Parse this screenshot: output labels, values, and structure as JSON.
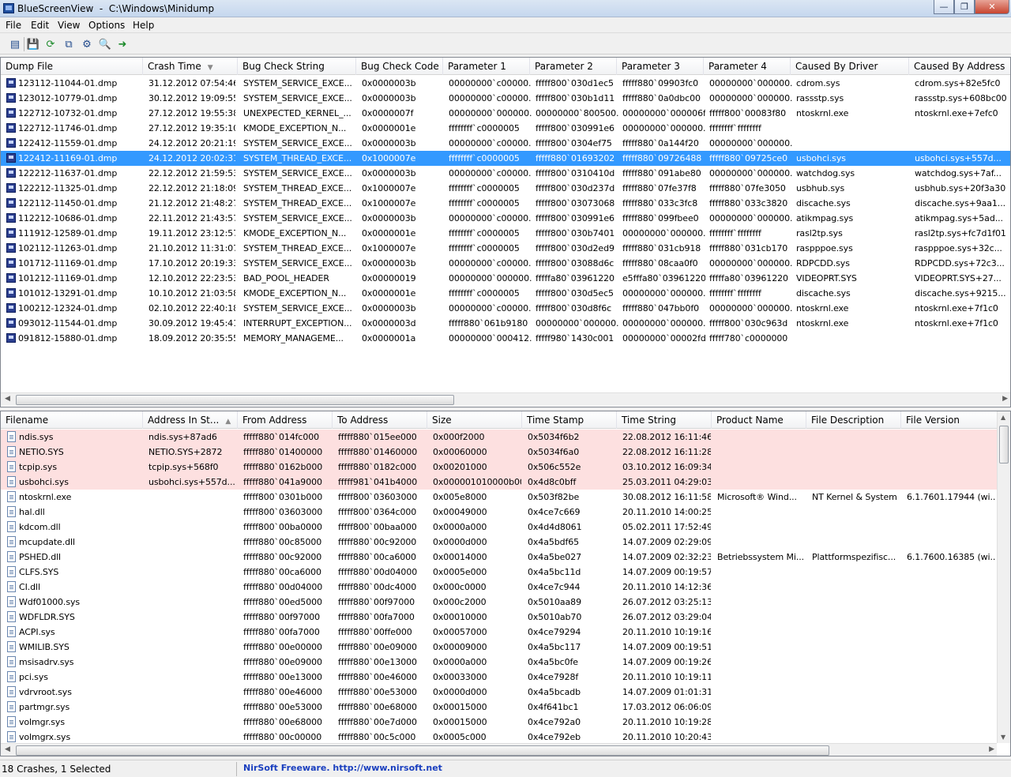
{
  "window": {
    "title": "BlueScreenView  -  C:\\Windows\\Minidump"
  },
  "menu": [
    "File",
    "Edit",
    "View",
    "Options",
    "Help"
  ],
  "toolbar_icons": [
    "properties-icon",
    "save-icon",
    "refresh-icon",
    "copy-icon",
    "advanced-options-icon",
    "find-icon",
    "exit-icon"
  ],
  "crashes": {
    "columns": [
      "Dump File",
      "Crash Time",
      "Bug Check String",
      "Bug Check Code",
      "Parameter 1",
      "Parameter 2",
      "Parameter 3",
      "Parameter 4",
      "Caused By Driver",
      "Caused By Address"
    ],
    "sort_column": "Crash Time",
    "selected_index": 5,
    "rows": [
      [
        "123112-11044-01.dmp",
        "31.12.2012 07:54:46",
        "SYSTEM_SERVICE_EXCE...",
        "0x0000003b",
        "00000000`c00000...",
        "fffff800`030d1ec5",
        "fffff880`09903fc0",
        "00000000`000000...",
        "cdrom.sys",
        "cdrom.sys+82e5fc0"
      ],
      [
        "123012-10779-01.dmp",
        "30.12.2012 19:09:55",
        "SYSTEM_SERVICE_EXCE...",
        "0x0000003b",
        "00000000`c00000...",
        "fffff800`030b1d11",
        "fffff880`0a0dbc00",
        "00000000`000000...",
        "rassstp.sys",
        "rassstp.sys+608bc00"
      ],
      [
        "122712-10732-01.dmp",
        "27.12.2012 19:55:38",
        "UNEXPECTED_KERNEL_...",
        "0x0000007f",
        "00000000`000000...",
        "00000000`800500...",
        "00000000`000006f8",
        "fffff800`00083f80",
        "ntoskrnl.exe",
        "ntoskrnl.exe+7efc0"
      ],
      [
        "122712-11746-01.dmp",
        "27.12.2012 19:35:10",
        "KMODE_EXCEPTION_N...",
        "0x0000001e",
        "ffffffff`c0000005",
        "fffff800`030991e6",
        "00000000`000000...",
        "ffffffff`ffffffff",
        "",
        ""
      ],
      [
        "122412-11559-01.dmp",
        "24.12.2012 20:21:19",
        "SYSTEM_SERVICE_EXCE...",
        "0x0000003b",
        "00000000`c00000...",
        "fffff800`0304ef75",
        "fffff880`0a144f20",
        "00000000`000000...",
        "",
        ""
      ],
      [
        "122412-11169-01.dmp",
        "24.12.2012 20:02:31",
        "SYSTEM_THREAD_EXCE...",
        "0x1000007e",
        "ffffffff`c0000005",
        "fffff880`01693202",
        "fffff880`09726488",
        "fffff880`09725ce0",
        "usbohci.sys",
        "usbohci.sys+557d..."
      ],
      [
        "122212-11637-01.dmp",
        "22.12.2012 21:59:53",
        "SYSTEM_SERVICE_EXCE...",
        "0x0000003b",
        "00000000`c00000...",
        "fffff800`0310410d",
        "fffff880`091abe80",
        "00000000`000000...",
        "watchdog.sys",
        "watchdog.sys+7af..."
      ],
      [
        "122212-11325-01.dmp",
        "22.12.2012 21:18:09",
        "SYSTEM_THREAD_EXCE...",
        "0x1000007e",
        "ffffffff`c0000005",
        "fffff800`030d237d",
        "fffff880`07fe37f8",
        "fffff880`07fe3050",
        "usbhub.sys",
        "usbhub.sys+20f3a30"
      ],
      [
        "122112-11450-01.dmp",
        "21.12.2012 21:48:27",
        "SYSTEM_THREAD_EXCE...",
        "0x1000007e",
        "ffffffff`c0000005",
        "fffff800`03073068",
        "fffff880`033c3fc8",
        "fffff880`033c3820",
        "discache.sys",
        "discache.sys+9aa1..."
      ],
      [
        "112212-10686-01.dmp",
        "22.11.2012 21:43:57",
        "SYSTEM_SERVICE_EXCE...",
        "0x0000003b",
        "00000000`c00000...",
        "fffff800`030991e6",
        "fffff880`099fbee0",
        "00000000`000000...",
        "atikmpag.sys",
        "atikmpag.sys+5ad..."
      ],
      [
        "111912-12589-01.dmp",
        "19.11.2012 23:12:57",
        "KMODE_EXCEPTION_N...",
        "0x0000001e",
        "ffffffff`c0000005",
        "fffff800`030b7401",
        "00000000`000000...",
        "ffffffff`ffffffff",
        "rasl2tp.sys",
        "rasl2tp.sys+fc7d1f01"
      ],
      [
        "102112-11263-01.dmp",
        "21.10.2012 11:31:07",
        "SYSTEM_THREAD_EXCE...",
        "0x1000007e",
        "ffffffff`c0000005",
        "fffff800`030d2ed9",
        "fffff880`031cb918",
        "fffff880`031cb170",
        "raspppoe.sys",
        "raspppoe.sys+32c..."
      ],
      [
        "101712-11169-01.dmp",
        "17.10.2012 20:19:33",
        "SYSTEM_SERVICE_EXCE...",
        "0x0000003b",
        "00000000`c00000...",
        "fffff800`03088d6c",
        "fffff880`08caa0f0",
        "00000000`000000...",
        "RDPCDD.sys",
        "RDPCDD.sys+72c3..."
      ],
      [
        "101212-11169-01.dmp",
        "12.10.2012 22:23:53",
        "BAD_POOL_HEADER",
        "0x00000019",
        "00000000`000000...",
        "fffffa80`03961220",
        "e5fffa80`03961220",
        "fffffa80`03961220",
        "VIDEOPRT.SYS",
        "VIDEOPRT.SYS+27..."
      ],
      [
        "101012-13291-01.dmp",
        "10.10.2012 21:03:58",
        "KMODE_EXCEPTION_N...",
        "0x0000001e",
        "ffffffff`c0000005",
        "fffff800`030d5ec5",
        "00000000`000000...",
        "ffffffff`ffffffff",
        "discache.sys",
        "discache.sys+9215..."
      ],
      [
        "100212-12324-01.dmp",
        "02.10.2012 22:40:18",
        "SYSTEM_SERVICE_EXCE...",
        "0x0000003b",
        "00000000`c00000...",
        "fffff800`030d8f6c",
        "fffff880`047bb0f0",
        "00000000`000000...",
        "ntoskrnl.exe",
        "ntoskrnl.exe+7f1c0"
      ],
      [
        "093012-11544-01.dmp",
        "30.09.2012 19:45:41",
        "INTERRUPT_EXCEPTION...",
        "0x0000003d",
        "fffff880`061b9180",
        "00000000`000000...",
        "00000000`000000...",
        "fffff800`030c963d",
        "ntoskrnl.exe",
        "ntoskrnl.exe+7f1c0"
      ],
      [
        "091812-15880-01.dmp",
        "18.09.2012 20:35:55",
        "MEMORY_MANAGEME...",
        "0x0000001a",
        "00000000`000412...",
        "fffff980`1430c001",
        "00000000`00002fd2",
        "fffff780`c0000000",
        "",
        ""
      ]
    ]
  },
  "drivers": {
    "columns": [
      "Filename",
      "Address In St...",
      "From Address",
      "To Address",
      "Size",
      "Time Stamp",
      "Time String",
      "Product Name",
      "File Description",
      "File Version"
    ],
    "sort_column": "Address In St...",
    "highlighted_rows": 4,
    "rows": [
      [
        "ndis.sys",
        "ndis.sys+87ad6",
        "fffff880`014fc000",
        "fffff880`015ee000",
        "0x000f2000",
        "0x5034f6b2",
        "22.08.2012 16:11:46",
        "",
        "",
        ""
      ],
      [
        "NETIO.SYS",
        "NETIO.SYS+2872",
        "fffff880`01400000",
        "fffff880`01460000",
        "0x00060000",
        "0x5034f6a0",
        "22.08.2012 16:11:28",
        "",
        "",
        ""
      ],
      [
        "tcpip.sys",
        "tcpip.sys+568f0",
        "fffff880`0162b000",
        "fffff880`0182c000",
        "0x00201000",
        "0x506c552e",
        "03.10.2012 16:09:34",
        "",
        "",
        ""
      ],
      [
        "usbohci.sys",
        "usbohci.sys+557d...",
        "fffff880`041a9000",
        "fffff981`041b4000",
        "0x000001010000b000",
        "0x4d8c0bff",
        "25.03.2011 04:29:03",
        "",
        "",
        ""
      ],
      [
        "ntoskrnl.exe",
        "",
        "fffff800`0301b000",
        "fffff800`03603000",
        "0x005e8000",
        "0x503f82be",
        "30.08.2012 16:11:58",
        "Microsoft® Wind...",
        "NT Kernel & System",
        "6.1.7601.17944 (wi..."
      ],
      [
        "hal.dll",
        "",
        "fffff800`03603000",
        "fffff800`0364c000",
        "0x00049000",
        "0x4ce7c669",
        "20.11.2010 14:00:25",
        "",
        "",
        ""
      ],
      [
        "kdcom.dll",
        "",
        "fffff800`00ba0000",
        "fffff800`00baa000",
        "0x0000a000",
        "0x4d4d8061",
        "05.02.2011 17:52:49",
        "",
        "",
        ""
      ],
      [
        "mcupdate.dll",
        "",
        "fffff880`00c85000",
        "fffff880`00c92000",
        "0x0000d000",
        "0x4a5bdf65",
        "14.07.2009 02:29:09",
        "",
        "",
        ""
      ],
      [
        "PSHED.dll",
        "",
        "fffff880`00c92000",
        "fffff880`00ca6000",
        "0x00014000",
        "0x4a5be027",
        "14.07.2009 02:32:23",
        "Betriebssystem Mi...",
        "Plattformspezifisc...",
        "6.1.7600.16385 (wi..."
      ],
      [
        "CLFS.SYS",
        "",
        "fffff880`00ca6000",
        "fffff880`00d04000",
        "0x0005e000",
        "0x4a5bc11d",
        "14.07.2009 00:19:57",
        "",
        "",
        ""
      ],
      [
        "CI.dll",
        "",
        "fffff880`00d04000",
        "fffff880`00dc4000",
        "0x000c0000",
        "0x4ce7c944",
        "20.11.2010 14:12:36",
        "",
        "",
        ""
      ],
      [
        "Wdf01000.sys",
        "",
        "fffff880`00ed5000",
        "fffff880`00f97000",
        "0x000c2000",
        "0x5010aa89",
        "26.07.2012 03:25:13",
        "",
        "",
        ""
      ],
      [
        "WDFLDR.SYS",
        "",
        "fffff880`00f97000",
        "fffff880`00fa7000",
        "0x00010000",
        "0x5010ab70",
        "26.07.2012 03:29:04",
        "",
        "",
        ""
      ],
      [
        "ACPI.sys",
        "",
        "fffff880`00fa7000",
        "fffff880`00ffe000",
        "0x00057000",
        "0x4ce79294",
        "20.11.2010 10:19:16",
        "",
        "",
        ""
      ],
      [
        "WMILIB.SYS",
        "",
        "fffff880`00e00000",
        "fffff880`00e09000",
        "0x00009000",
        "0x4a5bc117",
        "14.07.2009 00:19:51",
        "",
        "",
        ""
      ],
      [
        "msisadrv.sys",
        "",
        "fffff880`00e09000",
        "fffff880`00e13000",
        "0x0000a000",
        "0x4a5bc0fe",
        "14.07.2009 00:19:26",
        "",
        "",
        ""
      ],
      [
        "pci.sys",
        "",
        "fffff880`00e13000",
        "fffff880`00e46000",
        "0x00033000",
        "0x4ce7928f",
        "20.11.2010 10:19:11",
        "",
        "",
        ""
      ],
      [
        "vdrvroot.sys",
        "",
        "fffff880`00e46000",
        "fffff880`00e53000",
        "0x0000d000",
        "0x4a5bcadb",
        "14.07.2009 01:01:31",
        "",
        "",
        ""
      ],
      [
        "partmgr.sys",
        "",
        "fffff880`00e53000",
        "fffff880`00e68000",
        "0x00015000",
        "0x4f641bc1",
        "17.03.2012 06:06:09",
        "",
        "",
        ""
      ],
      [
        "volmgr.sys",
        "",
        "fffff880`00e68000",
        "fffff880`00e7d000",
        "0x00015000",
        "0x4ce792a0",
        "20.11.2010 10:19:28",
        "",
        "",
        ""
      ],
      [
        "volmgrx.sys",
        "",
        "fffff880`00c00000",
        "fffff880`00c5c000",
        "0x0005c000",
        "0x4ce792eb",
        "20.11.2010 10:20:43",
        "",
        "",
        ""
      ]
    ]
  },
  "status": {
    "count": "18 Crashes, 1 Selected",
    "link_text": "NirSoft Freeware.  http://www.nirsoft.net"
  },
  "colors": {
    "selection": "#3399ff",
    "highlight_row": "#fde0e0",
    "link": "#1a3fbf"
  }
}
